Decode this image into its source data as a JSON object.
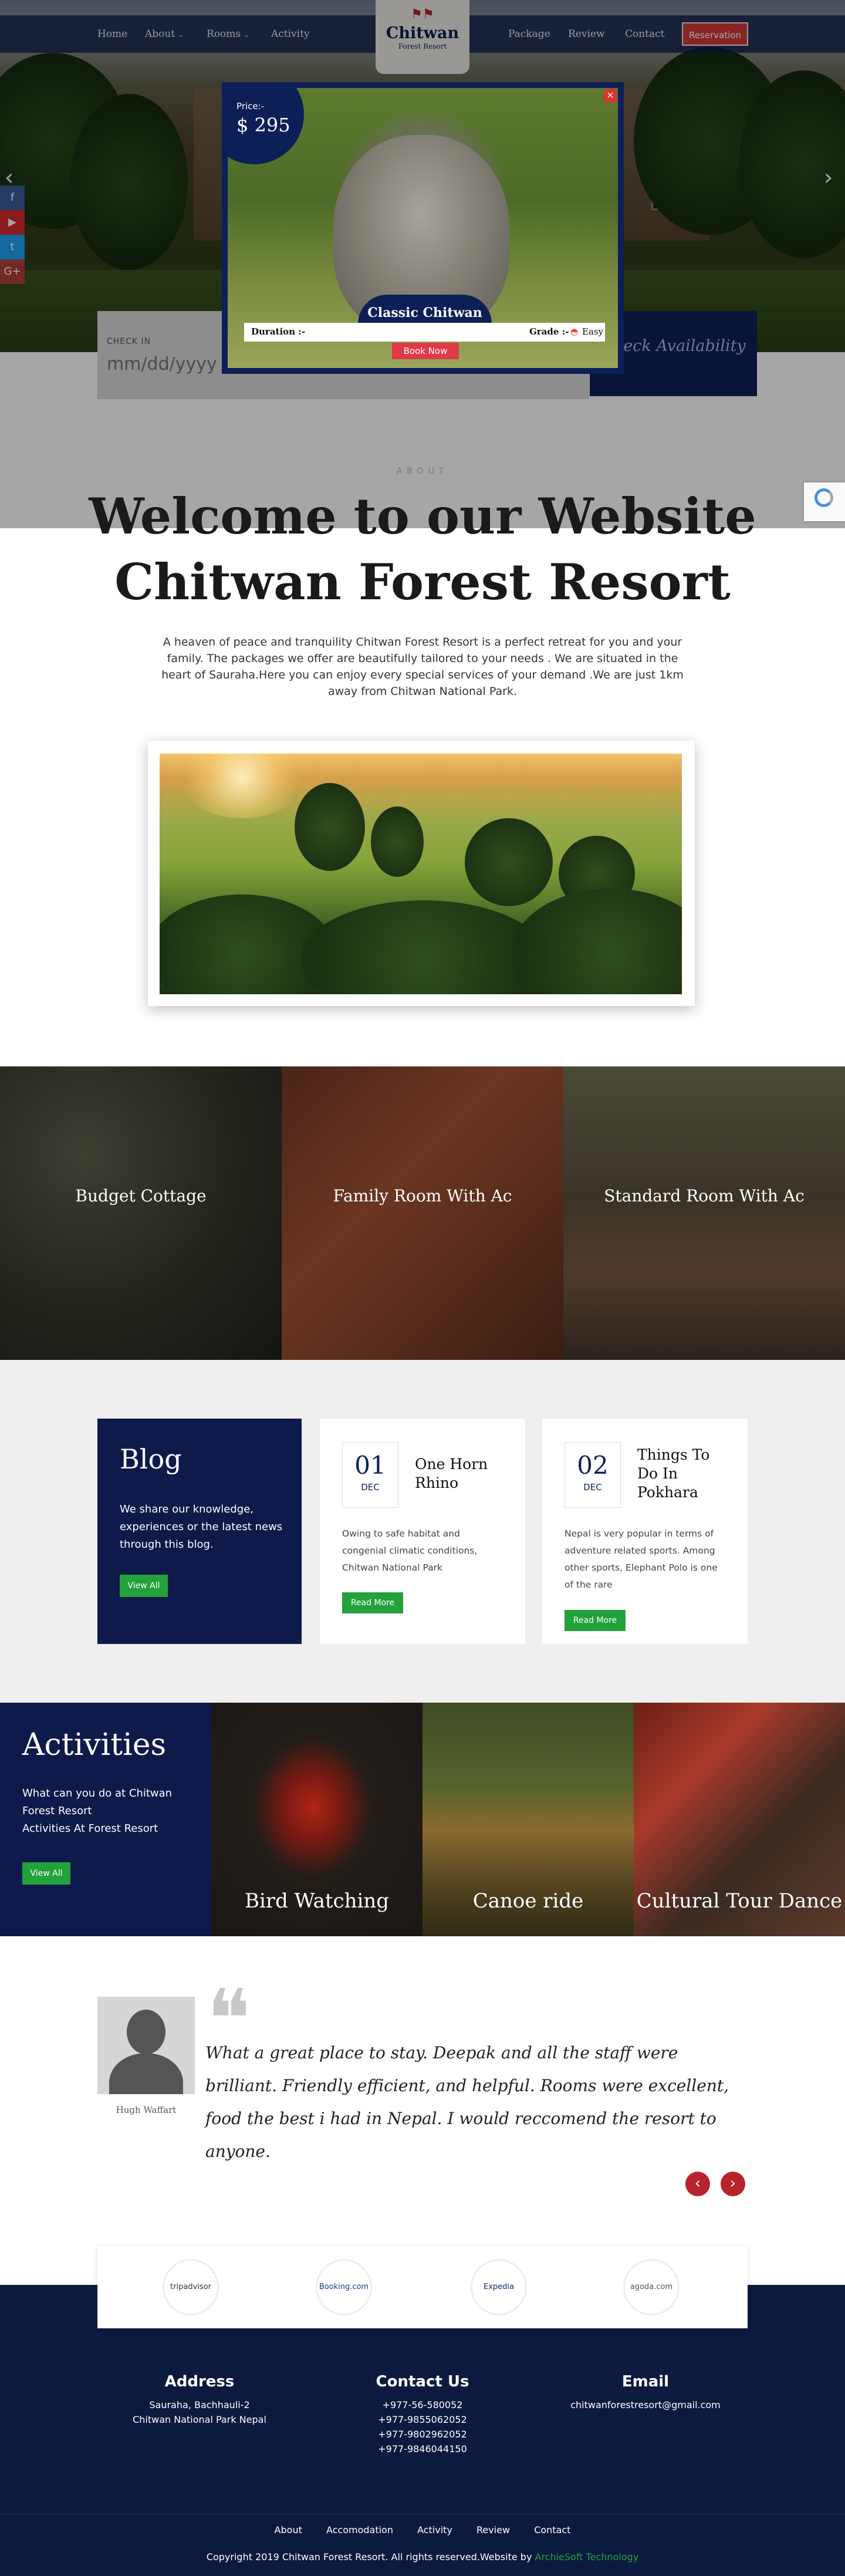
{
  "nav": {
    "left": [
      "Home",
      "About",
      "Rooms",
      "Activity"
    ],
    "right": [
      "Package",
      "Review",
      "Contact"
    ],
    "reservation": "Reservation",
    "logo_title": "Chitwan",
    "logo_subtitle": "Forest Resort"
  },
  "social": [
    {
      "icon": "facebook-icon",
      "glyph": "f",
      "color": "#3b5998"
    },
    {
      "icon": "youtube-icon",
      "glyph": "▶",
      "color": "#d42a2a"
    },
    {
      "icon": "twitter-icon",
      "glyph": "t",
      "color": "#1da1f2"
    },
    {
      "icon": "google-plus-icon",
      "glyph": "G+",
      "color": "#b0403a"
    }
  ],
  "booking": {
    "checkin_label": "CHECK IN",
    "checkin_placeholder": "mm/dd/yyyy",
    "check_availability": "Check Availability"
  },
  "modal": {
    "price_label": "Price:-",
    "price": "$ 295",
    "title": "Classic Chitwan",
    "duration_label": "Duration :-",
    "grade_label": "Grade :-",
    "grade": "Easy",
    "book_now": "Book Now",
    "close": "×"
  },
  "about": {
    "kicker": "ABOUT",
    "title_line1": "Welcome to our Website",
    "title_line2": "Chitwan Forest Resort",
    "text": "A heaven of peace and tranquility Chitwan Forest Resort is a perfect retreat for you and your family. The packages we offer are beautifully tailored to your needs . We are situated in the heart of Sauraha.Here you can enjoy every special services of your demand .We are just 1km away from Chitwan National Park."
  },
  "rooms": [
    "Budget Cottage",
    "Family Room With Ac",
    "Standard Room With Ac"
  ],
  "blog": {
    "title": "Blog",
    "text": "We share our knowledge, experiences or the latest news through this blog.",
    "view_all": "View All",
    "posts": [
      {
        "day": "01",
        "month": "DEC",
        "title_l1": "One Horn",
        "title_l2": "Rhino",
        "title_l3": "",
        "excerpt": "Owing to safe habitat and congenial climatic conditions, Chitwan National Park",
        "read_more": "Read More"
      },
      {
        "day": "02",
        "month": "DEC",
        "title_l1": "Things To",
        "title_l2": "Do In",
        "title_l3": "Pokhara",
        "excerpt": "Nepal is very popular in terms of adventure related sports. Among other sports, Elephant Polo is one of the rare",
        "read_more": "Read More"
      }
    ]
  },
  "activities": {
    "title": "Activities",
    "line1": "What can you do at Chitwan Forest Resort",
    "line2": "Activities At Forest Resort",
    "view_all": "View All",
    "items": [
      "Bird Watching",
      "Canoe ride",
      "Cultural Tour Dance"
    ]
  },
  "testimonial": {
    "name": "Hugh Waffart",
    "quote": "What a great place to stay. Deepak and all the staff were brilliant. Friendly efficient, and helpful. Rooms were excellent, food the best i had in Nepal. I would reccomend the resort to anyone.",
    "prev": "‹",
    "next": "›"
  },
  "partners": [
    "tripadvisor",
    "Booking.com",
    "Expedia",
    "agoda.com"
  ],
  "footer": {
    "address_title": "Address",
    "address_lines": [
      "Sauraha, Bachhauli-2",
      "Chitwan National Park Nepal"
    ],
    "contact_title": "Contact Us",
    "phones": [
      "+977-56-580052",
      "+977-9855062052",
      "+977-9802962052",
      "+977-9846044150"
    ],
    "email_title": "Email",
    "email": "chitwanforestresort@gmail.com",
    "links": [
      "About",
      "Accomodation",
      "Activity",
      "Review",
      "Contact"
    ],
    "copyright": "Copyright 2019 Chitwan Forest Resort. All rights reserved.Website by",
    "developer": "ArchieSoft Technology"
  }
}
